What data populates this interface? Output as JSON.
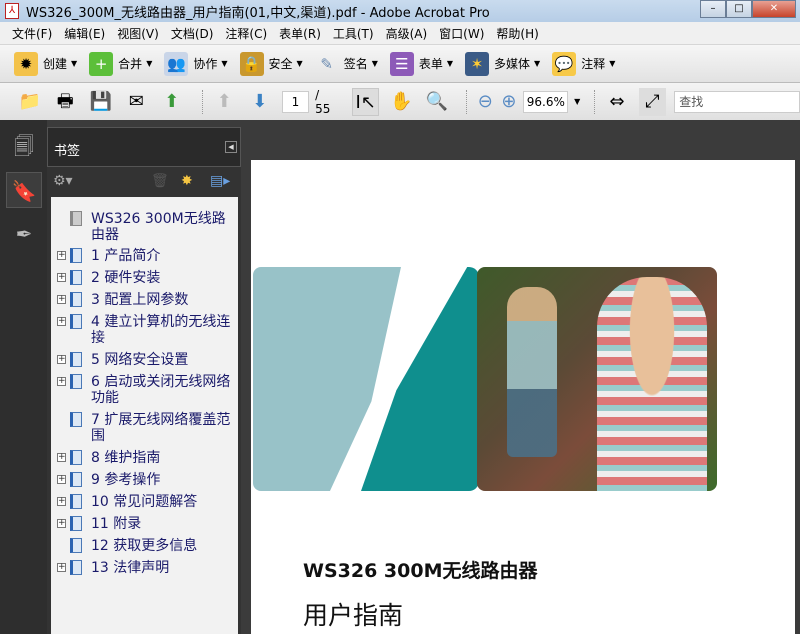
{
  "window": {
    "title": "WS326_300M_无线路由器_用户指南(01,中文,渠道).pdf - Adobe Acrobat Pro",
    "min": "–",
    "max": "□",
    "close": "✕"
  },
  "menu": [
    "文件(F)",
    "编辑(E)",
    "视图(V)",
    "文档(D)",
    "注释(C)",
    "表单(R)",
    "工具(T)",
    "高级(A)",
    "窗口(W)",
    "帮助(H)"
  ],
  "toolbar1": [
    {
      "label": "创建",
      "icon": "create-icon"
    },
    {
      "label": "合并",
      "icon": "combine-icon"
    },
    {
      "label": "协作",
      "icon": "collaborate-icon"
    },
    {
      "label": "安全",
      "icon": "lock-icon"
    },
    {
      "label": "签名",
      "icon": "pen-icon"
    },
    {
      "label": "表单",
      "icon": "form-icon"
    },
    {
      "label": "多媒体",
      "icon": "multimedia-icon"
    },
    {
      "label": "注释",
      "icon": "comment-icon"
    }
  ],
  "toolbar2": {
    "page_current": "1",
    "page_total": "/ 55",
    "zoom": "96.6%",
    "find_placeholder": "查找"
  },
  "panel": {
    "title": "书签"
  },
  "bookmarks": [
    {
      "label": "WS326 300M无线路由器",
      "expandable": false
    },
    {
      "label": "1 产品简介",
      "expandable": true
    },
    {
      "label": "2 硬件安装",
      "expandable": true
    },
    {
      "label": "3 配置上网参数",
      "expandable": true
    },
    {
      "label": "4 建立计算机的无线连接",
      "expandable": true
    },
    {
      "label": "5 网络安全设置",
      "expandable": true
    },
    {
      "label": "6 启动或关闭无线网络功能",
      "expandable": true
    },
    {
      "label": "7 扩展无线网络覆盖范围",
      "expandable": false
    },
    {
      "label": "8 维护指南",
      "expandable": true
    },
    {
      "label": "9 参考操作",
      "expandable": true
    },
    {
      "label": "10 常见问题解答",
      "expandable": true
    },
    {
      "label": "11 附录",
      "expandable": true
    },
    {
      "label": "12 获取更多信息",
      "expandable": false
    },
    {
      "label": "13 法律声明",
      "expandable": true
    }
  ],
  "document": {
    "product": "WS326 300M无线路由器",
    "title": "用户指南"
  }
}
